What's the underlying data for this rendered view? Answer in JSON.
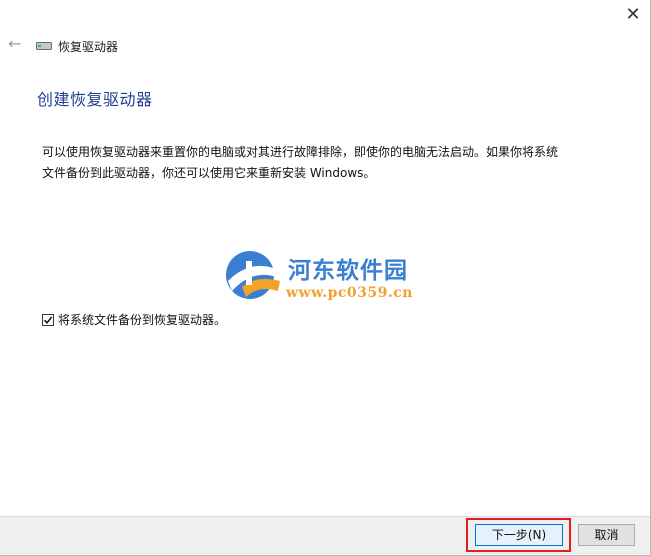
{
  "window": {
    "close_glyph": "✕",
    "back_glyph": "←",
    "title": "恢复驱动器"
  },
  "main": {
    "heading": "创建恢复驱动器",
    "description": "可以使用恢复驱动器来重置你的电脑或对其进行故障排除，即使你的电脑无法启动。如果你将系统文件备份到此驱动器，你还可以使用它来重新安装 Windows。",
    "checkbox": {
      "label": "将系统文件备份到恢复驱动器。",
      "checked": true
    }
  },
  "watermark": {
    "name": "河东软件园",
    "url": "www.pc0359.cn"
  },
  "footer": {
    "next_label": "下一步(N)",
    "cancel_label": "取消"
  },
  "colors": {
    "heading": "#1f3f8f",
    "highlight": "#e02020",
    "accent": "#0078d7"
  }
}
